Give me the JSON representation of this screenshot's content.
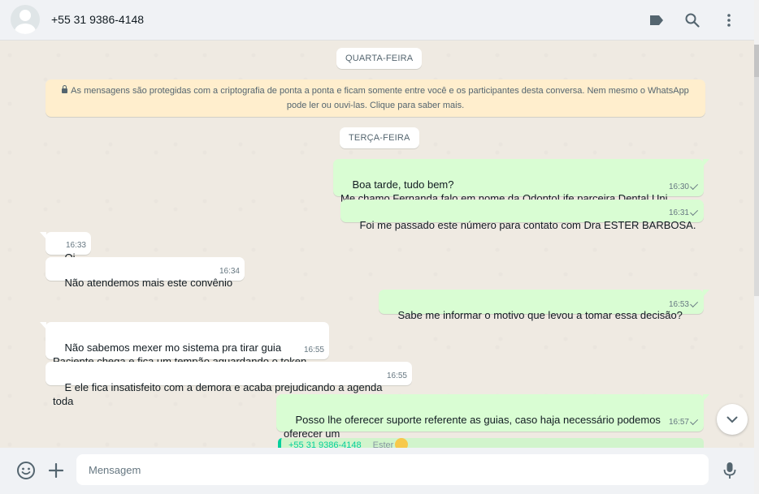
{
  "header": {
    "contact_name": "+55 31 9386-4148",
    "icons": [
      "label-icon",
      "search-icon",
      "menu-icon"
    ]
  },
  "chat": {
    "day1": "QUARTA-FEIRA",
    "notice_line1": "As mensagens são protegidas com a criptografia de ponta a ponta e ficam somente entre você e os participantes desta conversa. Nem mesmo o WhatsApp",
    "notice_line2": "pode ler ou ouvi-las. Clique para saber mais.",
    "day2": "TERÇA-FEIRA",
    "messages": [
      {
        "dir": "out",
        "text": "Boa tarde, tudo bem?\nMe chamo Fernanda falo em nome da OdontoLife parceira Dental Uni.",
        "time": "16:30"
      },
      {
        "dir": "out",
        "text": "Foi me passado este número para contato com Dra ESTER BARBOSA.",
        "time": "16:31"
      },
      {
        "dir": "in",
        "text": "Oi",
        "time": "16:33"
      },
      {
        "dir": "in",
        "text": "Não atendemos mais este convênio",
        "time": "16:34"
      },
      {
        "dir": "out",
        "text": "Sabe me informar o motivo que levou a tomar essa decisão?",
        "time": "16:53"
      },
      {
        "dir": "in",
        "text": "Não sabemos mexer mo sistema pra tirar guia\nPaciente chega e fica um tempão aguardando o token",
        "time": "16:55"
      },
      {
        "dir": "in",
        "text": "E ele fica insatisfeito com a demora e acaba prejudicando a agenda toda",
        "time": "16:55"
      },
      {
        "dir": "out",
        "text": "Posso lhe oferecer suporte referente as guias, caso haja necessário podemos oferecer um\ntreinamento/reciclagem sobre o sistema.",
        "time": "16:57"
      }
    ],
    "quote": {
      "author": "+55 31 9386-4148",
      "snippet": "Ester"
    }
  },
  "footer": {
    "placeholder": "Mensagem"
  },
  "colors": {
    "outgoing_bubble": "#d9fdd3",
    "incoming_bubble": "#ffffff",
    "chat_background": "#efeae2",
    "notice_background": "#ffeecd",
    "accent": "#06cf9c"
  }
}
